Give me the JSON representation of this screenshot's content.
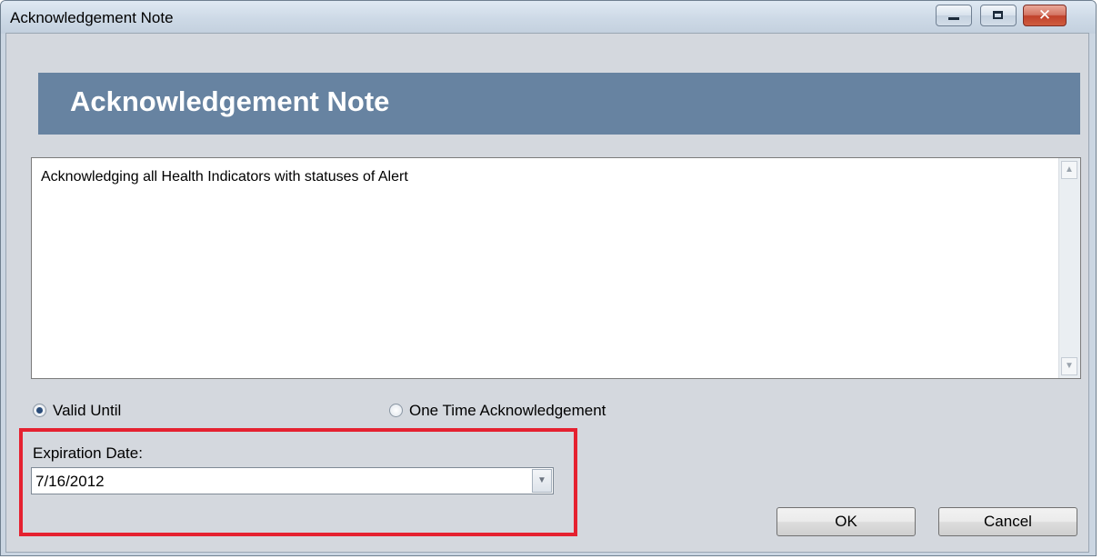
{
  "window": {
    "title": "Acknowledgement Note",
    "controls": {
      "minimize": "minimize",
      "maximize": "maximize",
      "close": "x"
    }
  },
  "header": {
    "title": "Acknowledgement Note"
  },
  "note": {
    "text": "Acknowledging all Health Indicators with statuses of Alert"
  },
  "options": {
    "valid_until": {
      "label": "Valid Until",
      "selected": true
    },
    "one_time": {
      "label": "One Time Acknowledgement",
      "selected": false
    }
  },
  "expiration": {
    "label": "Expiration Date:",
    "value": "7/16/2012"
  },
  "buttons": {
    "ok": "OK",
    "cancel": "Cancel"
  },
  "colors": {
    "header_band": "#6783a1",
    "highlight": "#e52130"
  }
}
